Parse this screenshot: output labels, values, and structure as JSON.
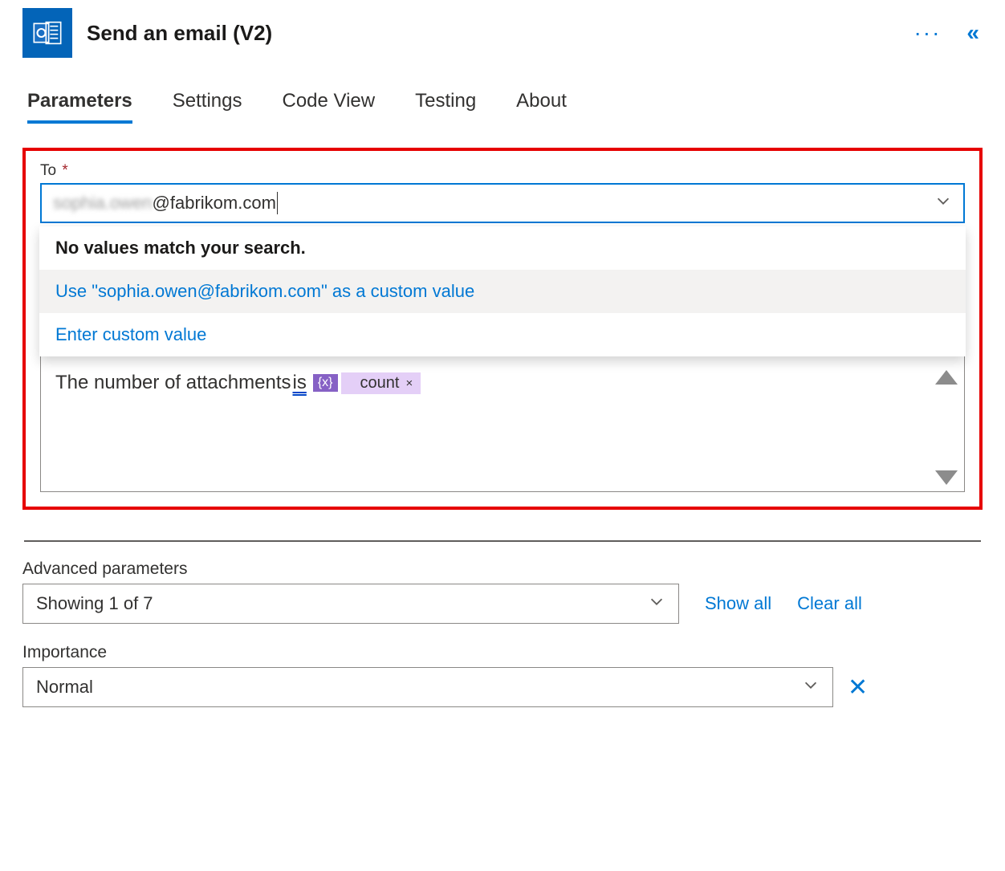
{
  "header": {
    "title": "Send an email (V2)",
    "more": "···",
    "collapse": "«"
  },
  "tabs": {
    "parameters": "Parameters",
    "settings": "Settings",
    "codeview": "Code View",
    "testing": "Testing",
    "about": "About"
  },
  "to_field": {
    "label": "To",
    "required_mark": "*",
    "value_blur": "sophia.owen",
    "value_rest": "@fabrikom.com"
  },
  "dropdown": {
    "no_match": "No values match your search.",
    "use_custom": "Use \"sophia.owen@fabrikom.com\" as a custom value",
    "enter_custom": "Enter custom value"
  },
  "body": {
    "text_prefix": "The number of attachments ",
    "text_is": "is",
    "var_glyph": "{x}",
    "token_label": "count",
    "token_close": "×"
  },
  "advanced": {
    "heading": "Advanced parameters",
    "showing": "Showing 1 of 7",
    "show_all": "Show all",
    "clear_all": "Clear all"
  },
  "importance": {
    "label": "Importance",
    "value": "Normal",
    "close": "✕"
  }
}
